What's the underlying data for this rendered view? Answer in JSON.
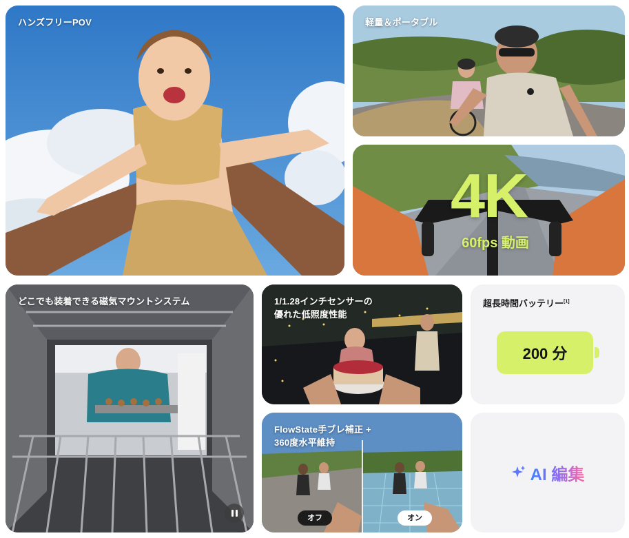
{
  "tiles": {
    "handsfree": {
      "label": "ハンズフリーPOV"
    },
    "portable": {
      "label": "軽量＆ポータブル"
    },
    "video4k": {
      "headline": "4K",
      "subline": "60fps 動画"
    },
    "magnetic": {
      "label": "どこでも装着できる磁気マウントシステム"
    },
    "lowlight": {
      "label": "1/1.28インチセンサーの\n優れた低照度性能"
    },
    "flowstate": {
      "label": "FlowState手ブレ補正 +\n360度水平維持",
      "off_label": "オフ",
      "on_label": "オン"
    },
    "battery": {
      "title": "超長時間バッテリー",
      "footnote": "[1]",
      "value": "200 分"
    },
    "ai": {
      "label": "AI 編集"
    }
  },
  "colors": {
    "accent_lime": "#d7f06a",
    "ai_gradient": [
      "#3d82ff",
      "#8a6cf3",
      "#ff6aa2"
    ]
  },
  "icons": {
    "pause": "pause-icon",
    "sparkle": "sparkle-icon"
  }
}
